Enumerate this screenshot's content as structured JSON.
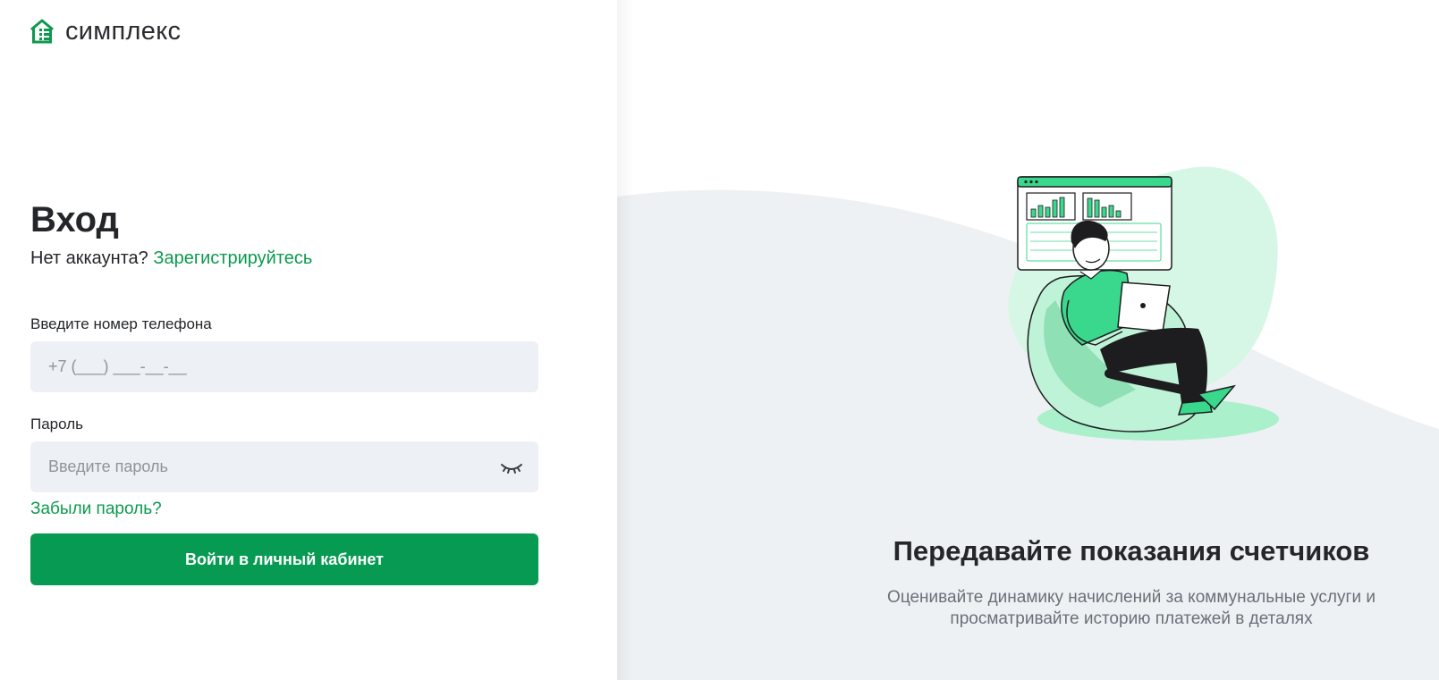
{
  "brand": {
    "name": "симплекс",
    "accent_color": "#079a52"
  },
  "login": {
    "title": "Вход",
    "no_account_text": "Нет аккаунта?",
    "register_link": "Зарегистрируйтесь",
    "phone_label": "Введите номер телефона",
    "phone_placeholder": "+7 (___) ___-__-__",
    "password_label": "Пароль",
    "password_placeholder": "Введите пароль",
    "password_toggle_icon": "eye-closed-icon",
    "forgot_link": "Забыли пароль?",
    "submit_label": "Войти в личный кабинет"
  },
  "promo": {
    "title": "Передавайте показания счетчиков",
    "text": "Оценивайте динамику начислений за коммунальные услуги и просматривайте историю платежей в деталях",
    "illustration": "man-with-laptop-on-beanbag"
  }
}
